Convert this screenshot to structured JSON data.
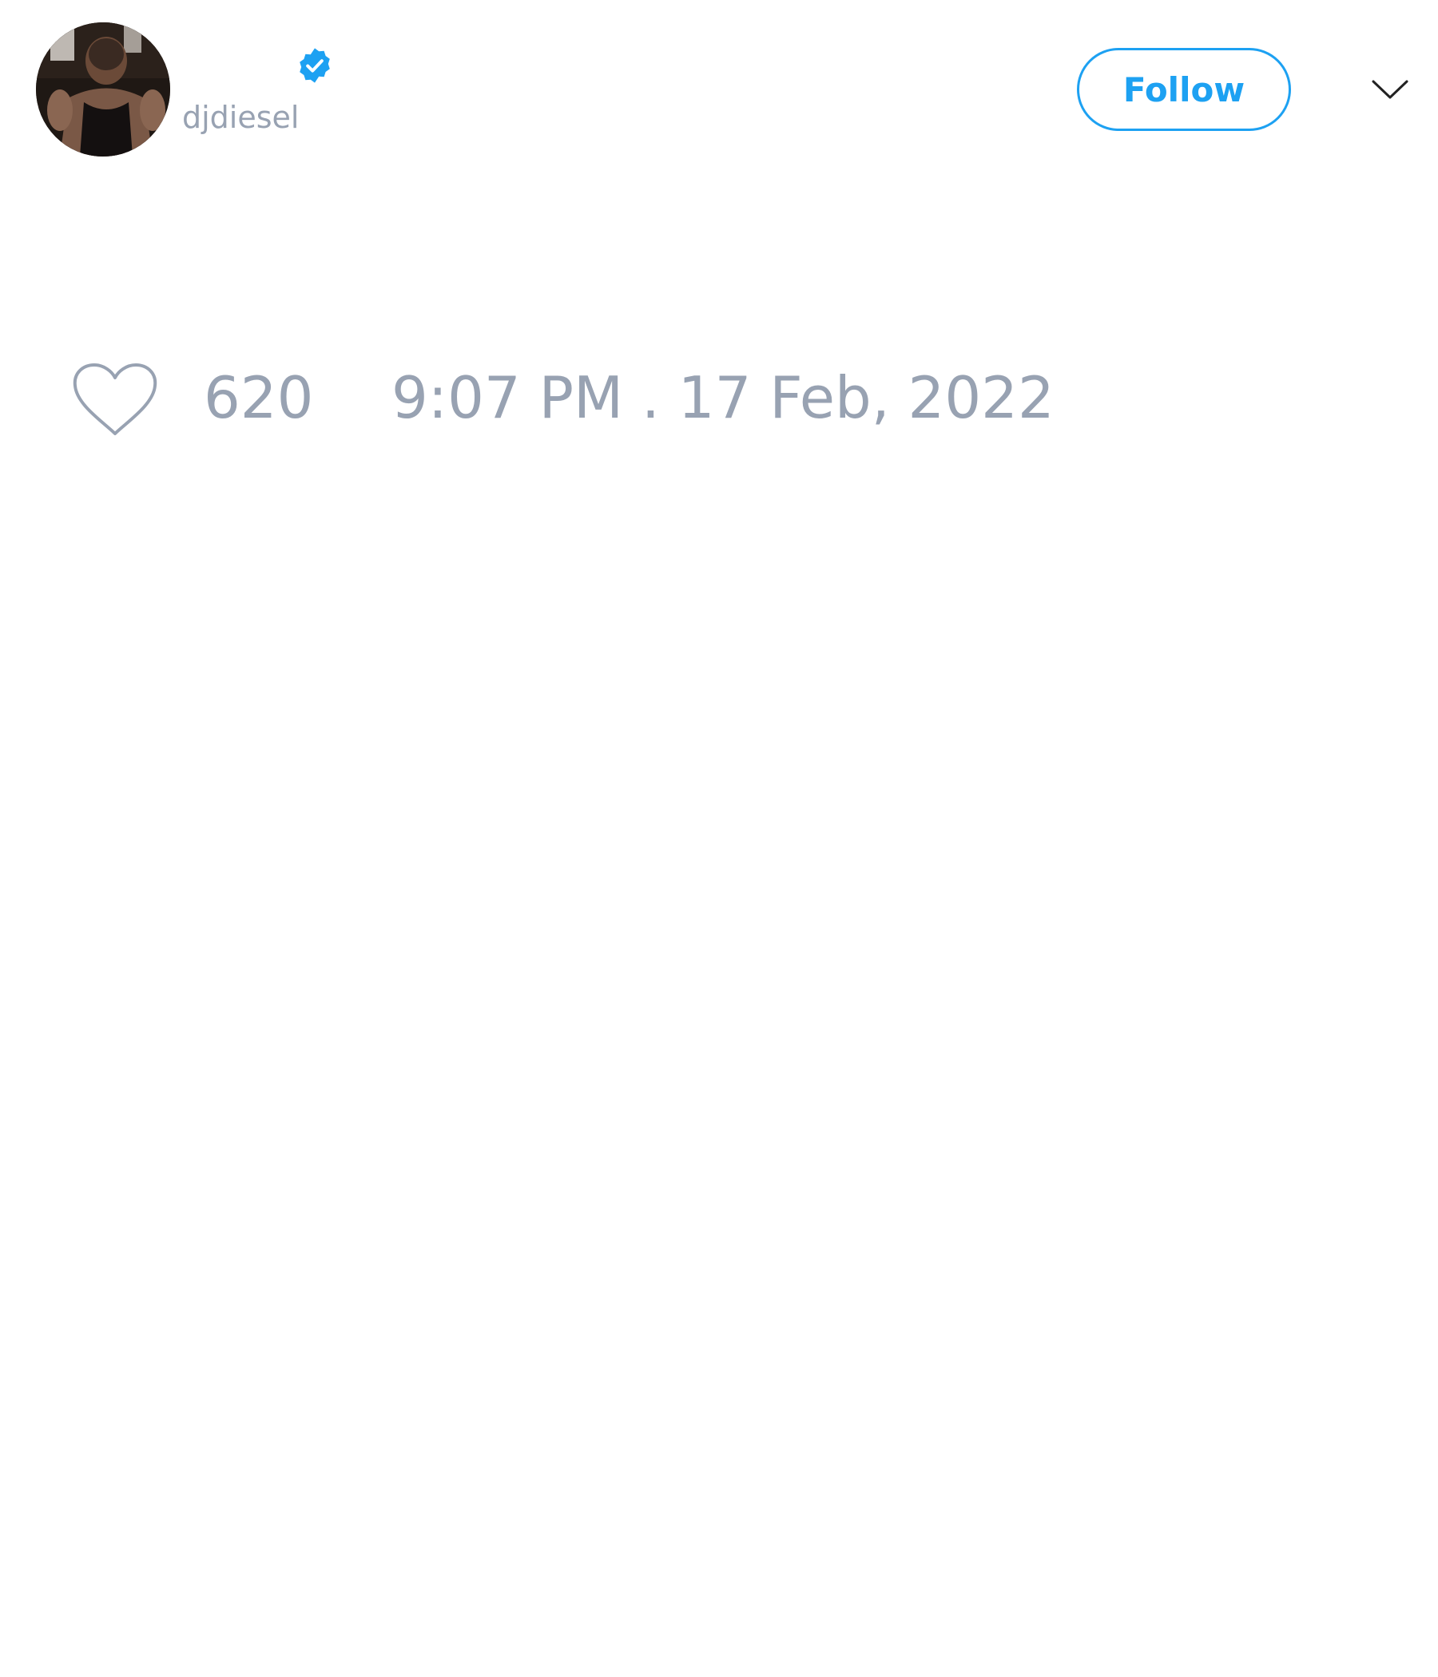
{
  "tweet": {
    "author": {
      "display_name": "",
      "handle": "djdiesel",
      "verified": true,
      "avatar_icon": "profile-photo"
    },
    "follow_label": "Follow",
    "menu_icon": "chevron-down-icon",
    "likes": {
      "icon": "heart-icon",
      "count": "620"
    },
    "timestamp": "9:07 PM . 17 Feb, 2022"
  },
  "colors": {
    "accent": "#1da1f2",
    "muted_text": "#98a2b2",
    "background": "#ffffff"
  }
}
